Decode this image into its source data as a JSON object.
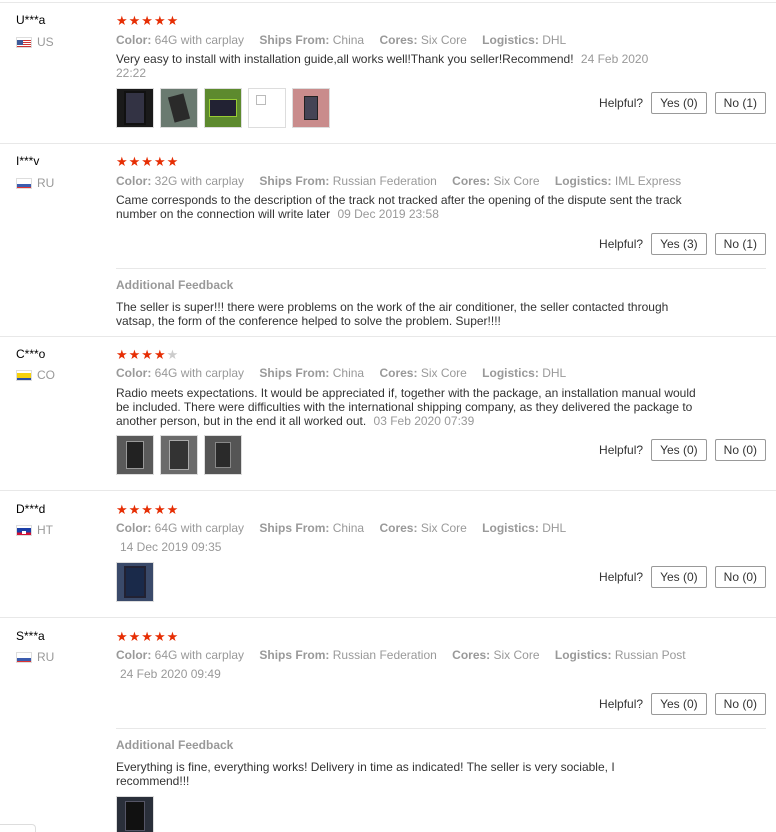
{
  "helpful_label": "Helpful?",
  "labels": {
    "color": "Color:",
    "ships_from": "Ships From:",
    "cores": "Cores:",
    "logistics": "Logistics:"
  },
  "additional_feedback_label": "Additional Feedback",
  "reviews": [
    {
      "user": "U***a",
      "country": "US",
      "stars": 5,
      "color": "64G with carplay",
      "ships_from": "China",
      "cores": "Six Core",
      "logistics": "DHL",
      "text": "Very easy to install with installation guide,all works well!Thank you seller!Recommend!",
      "date": "24 Feb 2020 22:22",
      "photo_count": 5,
      "yes": "Yes (0)",
      "no": "No (1)"
    },
    {
      "user": "I***v",
      "country": "RU",
      "stars": 5,
      "color": "32G with carplay",
      "ships_from": "Russian Federation",
      "cores": "Six Core",
      "logistics": "IML Express",
      "text": "Came corresponds to the description of the track not tracked after the opening of the dispute sent the track number on the connection will write later",
      "date": "09 Dec 2019 23:58",
      "yes": "Yes (3)",
      "no": "No (1)",
      "additional": "The seller is super!!! there were problems on the work of the air conditioner, the seller contacted through vatsap, the form of the conference helped to solve the problem. Super!!!!"
    },
    {
      "user": "C***o",
      "country": "CO",
      "stars": 4,
      "color": "64G with carplay",
      "ships_from": "China",
      "cores": "Six Core",
      "logistics": "DHL",
      "text": "Radio meets expectations. It would be appreciated if, together with the package, an installation manual would be included. There were difficulties with the international shipping company, as they delivered the package to another person, but in the end it all worked out.",
      "date": "03 Feb 2020 07:39",
      "photo_count": 3,
      "yes": "Yes (0)",
      "no": "No (0)"
    },
    {
      "user": "D***d",
      "country": "HT",
      "stars": 5,
      "color": "64G with carplay",
      "ships_from": "China",
      "cores": "Six Core",
      "logistics": "DHL",
      "date": "14 Dec 2019 09:35",
      "photo_count": 1,
      "yes": "Yes (0)",
      "no": "No (0)"
    },
    {
      "user": "S***a",
      "country": "RU",
      "stars": 5,
      "color": "64G with carplay",
      "ships_from": "Russian Federation",
      "cores": "Six Core",
      "logistics": "Russian Post",
      "date": "24 Feb 2020 09:49",
      "yes": "Yes (0)",
      "no": "No (0)",
      "additional": "Everything is fine, everything works! Delivery in time as indicated! The seller is very sociable, I recommend!!!",
      "additional_photo_count": 1
    }
  ],
  "colors": {
    "star": "#e62e04",
    "star_off": "#cccccc",
    "muted": "#999999",
    "separator": "#e8e8e8"
  }
}
